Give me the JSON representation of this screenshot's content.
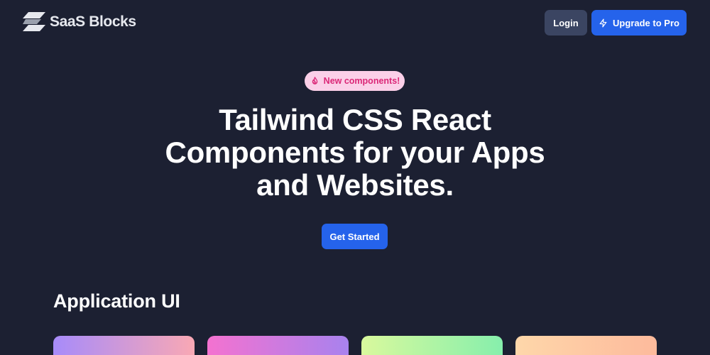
{
  "header": {
    "brand": "SaaS Blocks",
    "login_label": "Login",
    "upgrade_label": "Upgrade to Pro",
    "upgrade_icon": "bolt-icon"
  },
  "badge": {
    "label": "New components!",
    "icon": "flame-icon"
  },
  "hero": {
    "title_lines": [
      "Tailwind CSS React",
      "Components for your Apps",
      "and Websites."
    ],
    "cta_label": "Get Started"
  },
  "section": {
    "title": "Application UI",
    "cards": [
      {
        "gradient": [
          "#a78bfa",
          "#f9a8b4"
        ]
      },
      {
        "gradient": [
          "#f472d0",
          "#a882ee"
        ]
      },
      {
        "gradient": [
          "#d9f99d",
          "#86efac"
        ]
      },
      {
        "gradient": [
          "#fed7aa",
          "#fdba9c"
        ]
      }
    ]
  },
  "colors": {
    "background": "#1c2032",
    "primary": "#2563eb",
    "login_button": "#3b4562",
    "badge_bg": "#fbcfe8",
    "badge_text": "#db2777"
  }
}
